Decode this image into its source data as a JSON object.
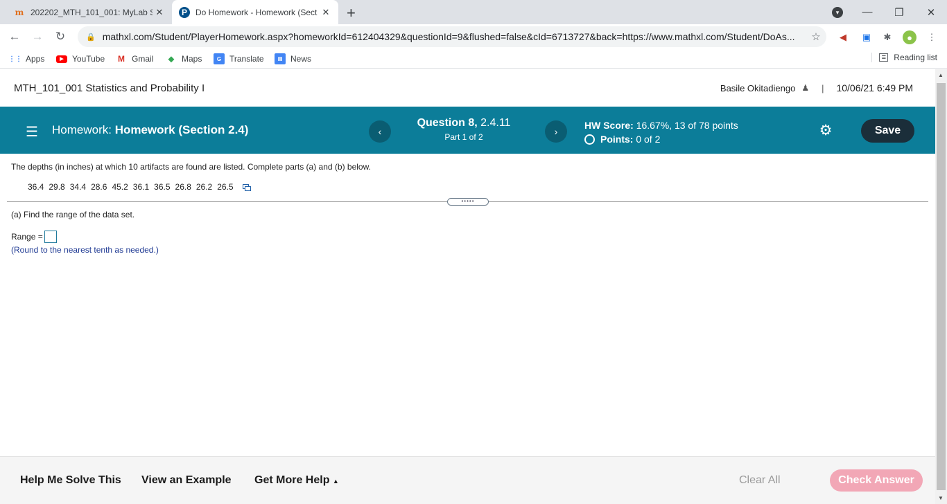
{
  "browser": {
    "tabs": [
      {
        "title": "202202_MTH_101_001: MyLab St",
        "icon": "mylab-icon",
        "active": false
      },
      {
        "title": "Do Homework - Homework (Sect",
        "icon": "pearson-icon",
        "active": true
      }
    ],
    "url": "mathxl.com/Student/PlayerHomework.aspx?homeworkId=612404329&questionId=9&flushed=false&cId=6713727&back=https://www.mathxl.com/Student/DoAs...",
    "bookmarks": [
      "Apps",
      "YouTube",
      "Gmail",
      "Maps",
      "Translate",
      "News"
    ],
    "reading_list": "Reading list"
  },
  "header": {
    "course": "MTH_101_001 Statistics and Probability I",
    "user": "Basile Okitadiengo",
    "datetime": "10/06/21 6:49 PM"
  },
  "hw": {
    "label": "Homework:",
    "name": "Homework (Section 2.4)",
    "question_label": "Question 8,",
    "question_ref": "2.4.11",
    "part": "Part 1 of 2",
    "score_label": "HW Score:",
    "score_value": "16.67%, 13 of 78 points",
    "points_label": "Points:",
    "points_value": "0 of 2",
    "save": "Save"
  },
  "problem": {
    "statement": "The depths (in inches) at which 10 artifacts are found are listed. Complete parts (a) and (b) below.",
    "data": [
      "36.4",
      "29.8",
      "34.4",
      "28.6",
      "45.2",
      "36.1",
      "36.5",
      "26.8",
      "26.2",
      "26.5"
    ],
    "part_a": "(a) Find the range of the data set.",
    "range_label": "Range =",
    "range_value": "",
    "round_note": "(Round to the nearest tenth as needed.)"
  },
  "footer": {
    "help_me_solve": "Help Me Solve This",
    "view_example": "View an Example",
    "get_more_help": "Get More Help",
    "clear_all": "Clear All",
    "check_answer": "Check Answer"
  }
}
